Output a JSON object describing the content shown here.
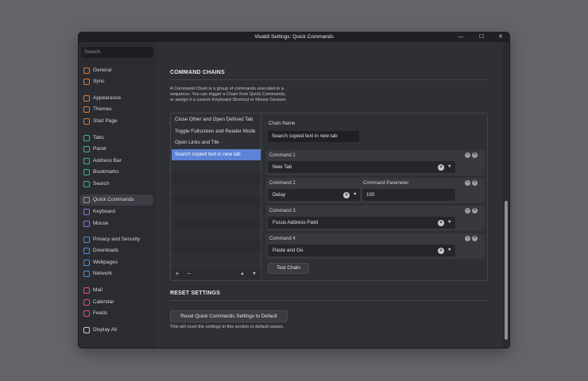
{
  "window": {
    "title": "Vivaldi Settings: Quick Commands",
    "minimize_label": "—",
    "maximize_label": "☐",
    "close_label": "✕"
  },
  "sidebar": {
    "search_placeholder": "Search",
    "items": [
      {
        "label": "General",
        "icon": "gear-icon",
        "color": "#e07a2e"
      },
      {
        "label": "Sync",
        "icon": "sync-icon",
        "color": "#e07a2e"
      },
      {
        "label": "Appearance",
        "icon": "palette-icon",
        "color": "#e07a2e"
      },
      {
        "label": "Themes",
        "icon": "brush-icon",
        "color": "#e07a2e"
      },
      {
        "label": "Start Page",
        "icon": "grid-icon",
        "color": "#e07a2e"
      },
      {
        "label": "Tabs",
        "icon": "tabs-icon",
        "color": "#3db58a"
      },
      {
        "label": "Panel",
        "icon": "panel-icon",
        "color": "#3db58a"
      },
      {
        "label": "Address Bar",
        "icon": "address-bar-icon",
        "color": "#3db58a"
      },
      {
        "label": "Bookmarks",
        "icon": "bookmark-icon",
        "color": "#3db58a"
      },
      {
        "label": "Search",
        "icon": "search-icon",
        "color": "#3db58a"
      },
      {
        "label": "Quick Commands",
        "icon": "quick-commands-icon",
        "color": "#9a9aa0"
      },
      {
        "label": "Keyboard",
        "icon": "keyboard-icon",
        "color": "#8a7ae0"
      },
      {
        "label": "Mouse",
        "icon": "mouse-icon",
        "color": "#8a7ae0"
      },
      {
        "label": "Privacy and Security",
        "icon": "shield-icon",
        "color": "#4a90e2"
      },
      {
        "label": "Downloads",
        "icon": "download-icon",
        "color": "#4a90e2"
      },
      {
        "label": "Webpages",
        "icon": "globe-icon",
        "color": "#4a90e2"
      },
      {
        "label": "Network",
        "icon": "network-icon",
        "color": "#4a90e2"
      },
      {
        "label": "Mail",
        "icon": "mail-icon",
        "color": "#e04a7a"
      },
      {
        "label": "Calendar",
        "icon": "calendar-icon",
        "color": "#e04a7a"
      },
      {
        "label": "Feeds",
        "icon": "rss-icon",
        "color": "#e04a7a"
      },
      {
        "label": "Display All",
        "icon": "gear-outline-icon",
        "color": "#c8c8cc"
      }
    ],
    "active": "Quick Commands"
  },
  "command_chains": {
    "heading": "COMMAND CHAINS",
    "description_line1": "A Command Chain is a group of commands executed in a",
    "description_line2": "sequence. You can trigger a Chain from Quick Commands,",
    "description_line3": "or assign it a custom Keyboard Shortcut or Mouse Gesture.",
    "chains": [
      "Close Other and Open Defined Tab",
      "Toggle Fullscreen and Reader Mode",
      "Open Links and Tile",
      "Search copied text in new tab"
    ],
    "selected_index": 3,
    "add_label": "+",
    "remove_label": "−",
    "move_up_label": "▲",
    "move_down_label": "▼",
    "chain_name_label": "Chain Name",
    "chain_name_value": "Search copied text in new tab",
    "commands": [
      {
        "label": "Command 1",
        "value": "New Tab"
      },
      {
        "label": "Command 2",
        "value": "Delay",
        "param_label": "Command Parameter",
        "param_value": "100"
      },
      {
        "label": "Command 3",
        "value": "Focus Address Field"
      },
      {
        "label": "Command 4",
        "value": "Paste and Go"
      }
    ],
    "test_button": "Test Chain",
    "remove_cmd_glyph": "−",
    "add_cmd_glyph": "+"
  },
  "reset": {
    "heading": "RESET SETTINGS",
    "button": "Reset Quick Commands Settings to Default",
    "note": "This will reset the settings in this section to default values."
  }
}
